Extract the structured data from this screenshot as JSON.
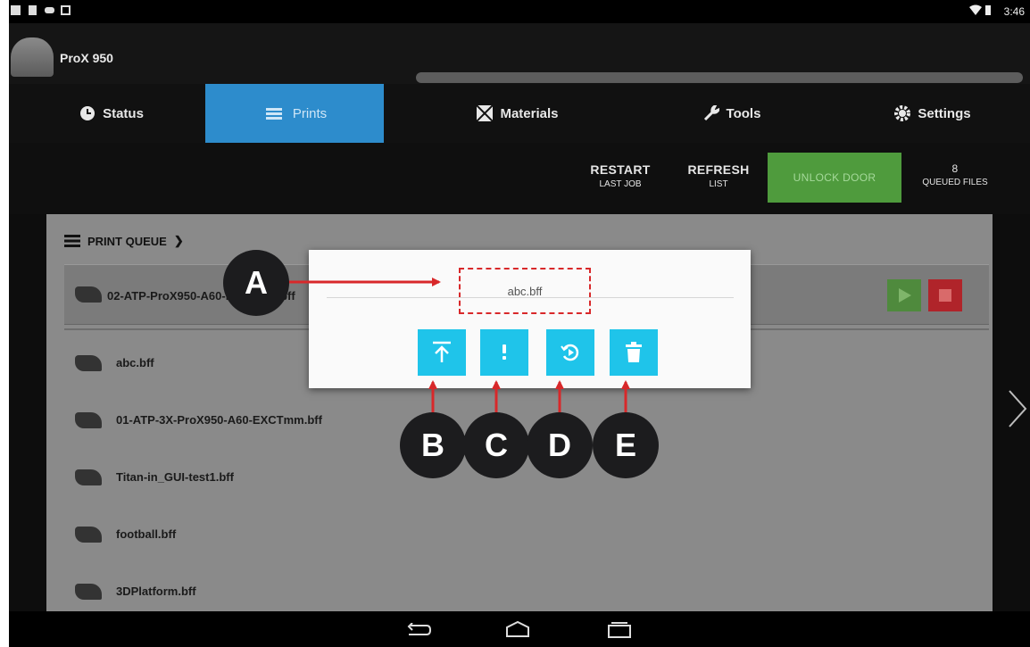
{
  "status_bar": {
    "time": "3:46"
  },
  "header": {
    "printer_name": "ProX 950"
  },
  "tabs": [
    {
      "label": "Status",
      "icon": "clock-icon"
    },
    {
      "label": "Prints",
      "icon": "list-icon",
      "active": true
    },
    {
      "label": "Materials",
      "icon": "materials-icon"
    },
    {
      "label": "Tools",
      "icon": "wrench-icon"
    },
    {
      "label": "Settings",
      "icon": "gear-icon"
    }
  ],
  "actions": {
    "restart": {
      "line1": "RESTART",
      "line2": "LAST JOB"
    },
    "refresh": {
      "line1": "REFRESH",
      "line2": "LIST"
    },
    "unlock": {
      "label": "UNLOCK DOOR"
    },
    "queued": {
      "count": "8",
      "label": "QUEUED FILES"
    }
  },
  "queue": {
    "title": "PRINT QUEUE",
    "current_file": "02-ATP-ProX950-A60-EXCTmm.bff",
    "items": [
      "abc.bff",
      "01-ATP-3X-ProX950-A60-EXCTmm.bff",
      "Titan-in_GUI-test1.bff",
      "football.bff",
      "3DPlatform.bff"
    ]
  },
  "dialog": {
    "title": "abc.bff",
    "buttons": [
      {
        "icon": "move-to-top-icon"
      },
      {
        "icon": "info-icon"
      },
      {
        "icon": "reprint-icon"
      },
      {
        "icon": "trash-icon"
      }
    ]
  },
  "callouts": [
    "A",
    "B",
    "C",
    "D",
    "E"
  ],
  "colors": {
    "accent_blue": "#2d8ccc",
    "dialog_button": "#1fc4ea",
    "unlock_green": "#4f9b3d",
    "annotation_red": "#d8282a",
    "callout_dark": "#1c1c1e"
  }
}
